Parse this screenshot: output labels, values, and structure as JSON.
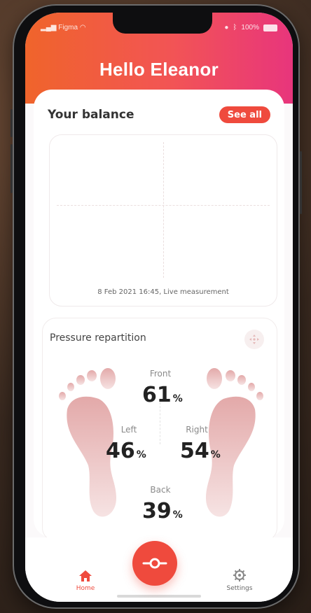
{
  "status_bar": {
    "carrier": "Figma",
    "battery": "100%"
  },
  "header": {
    "title": "Hello Eleanor"
  },
  "balance": {
    "title": "Your balance",
    "see_all_label": "See all",
    "timestamp": "8 Feb 2021 16:45, Live measurement"
  },
  "pressure": {
    "title": "Pressure repartition",
    "front": {
      "label": "Front",
      "value": "61",
      "unit": "%"
    },
    "left": {
      "label": "Left",
      "value": "46",
      "unit": "%"
    },
    "right": {
      "label": "Right",
      "value": "54",
      "unit": "%"
    },
    "back": {
      "label": "Back",
      "value": "39",
      "unit": "%"
    }
  },
  "nav": {
    "home_label": "Home",
    "settings_label": "Settings"
  },
  "colors": {
    "accent": "#ef4a3d",
    "header_gradient_start": "#f0642b",
    "header_gradient_end": "#e8357c",
    "foot_tint": "#e7b3b3"
  },
  "icons": {
    "home": "home-icon",
    "settings": "gear-icon",
    "fab": "connect-icon",
    "move": "move-icon"
  }
}
